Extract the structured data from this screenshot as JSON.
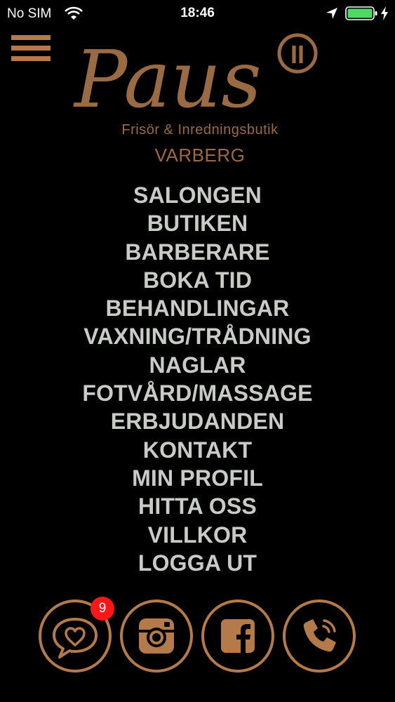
{
  "status_bar": {
    "carrier": "No SIM",
    "time": "18:46",
    "icons": [
      "wifi-icon",
      "location-arrow-icon",
      "battery-icon",
      "charging-bolt-icon"
    ],
    "battery_color": "#4cd964"
  },
  "header": {
    "menu_icon": "hamburger-icon",
    "logo_text": "Paus",
    "logo_mark": "II",
    "subtitle": "Frisör & Inredningsbutik",
    "city": "VARBERG"
  },
  "menu": {
    "items": [
      "SALONGEN",
      "BUTIKEN",
      "BARBERARE",
      "BOKA TID",
      "BEHANDLINGAR",
      "VAXNING/TRÅDNING",
      "NAGLAR",
      "FOTVÅRD/MASSAGE",
      "ERBJUDANDEN",
      "KONTAKT",
      "MIN PROFIL",
      "HITTA OSS",
      "VILLKOR",
      "LOGGA UT"
    ]
  },
  "footer": {
    "buttons": [
      "chat-heart-icon",
      "instagram-icon",
      "facebook-icon",
      "phone-icon"
    ],
    "badge_count": "9"
  },
  "colors": {
    "background": "#000000",
    "accent": "#b47a4a",
    "menu_text": "#c9cbc6",
    "badge": "#ff1717"
  }
}
